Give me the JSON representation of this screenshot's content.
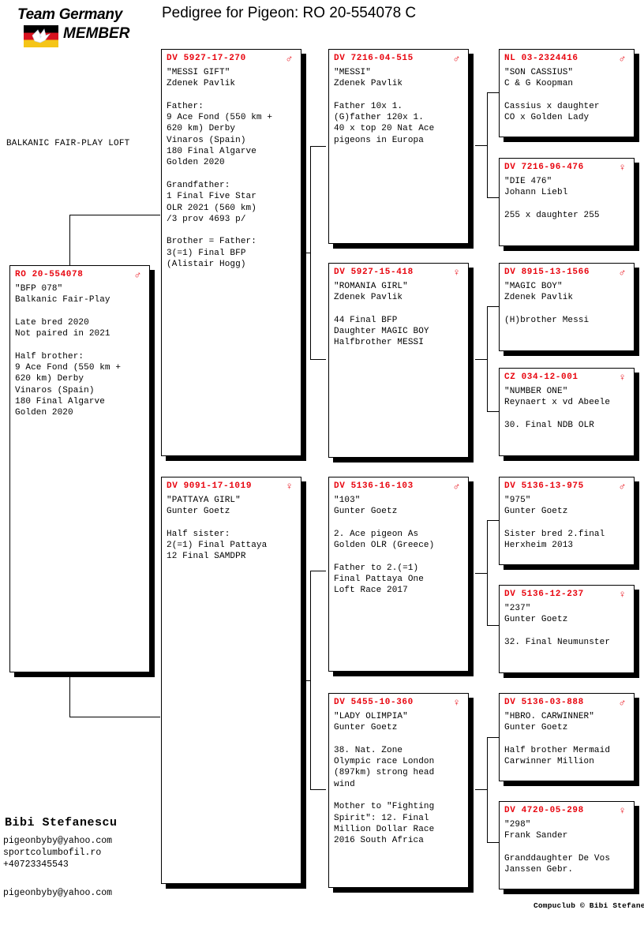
{
  "logo": {
    "line1": "Team Germany",
    "line2": "MEMBER",
    "flag_colors": [
      "#000000",
      "#d8121f",
      "#f5c518"
    ],
    "bird_icon": "dove-icon"
  },
  "header": {
    "title": "Pedigree for Pigeon: RO  20-554078 C"
  },
  "loft": {
    "name": "BALKANIC FAIR-PLAY LOFT"
  },
  "colors": {
    "ring_number": "#e8050f",
    "text": "#000000",
    "background": "#ffffff",
    "shadow": "#000000"
  },
  "symbols": {
    "male": "♂",
    "female": "♀"
  },
  "subject": {
    "ring": "RO   20-554078",
    "sex": "male",
    "body": "\"BFP 078\"\nBalkanic Fair-Play\n\nLate bred 2020\nNot paired in 2021\n\nHalf brother:\n9 Ace Fond (550 km +\n620 km) Derby\nVinaros (Spain)\n180 Final Algarve\nGolden 2020"
  },
  "generation1": [
    {
      "ring": "DV   5927-17-270",
      "sex": "male",
      "body": "\"MESSI GIFT\"\nZdenek Pavlik\n\nFather:\n9 Ace Fond (550 km +\n620 km) Derby\nVinaros (Spain)\n180 Final Algarve\nGolden 2020\n\nGrandfather:\n1 Final Five Star\nOLR 2021 (560 km)\n/3 prov 4693 p/\n\nBrother = Father:\n3(=1) Final BFP\n(Alistair Hogg)"
    },
    {
      "ring": "DV   9091-17-1019",
      "sex": "female",
      "body": "\"PATTAYA GIRL\"\nGunter Goetz\n\nHalf sister:\n2(=1) Final Pattaya\n12 Final SAMDPR"
    }
  ],
  "generation2": [
    {
      "ring": "DV   7216-04-515",
      "sex": "male",
      "body": "\"MESSI\"\nZdenek Pavlik\n\nFather 10x 1.\n(G)father 120x 1.\n40 x top 20 Nat Ace\npigeons in Europa"
    },
    {
      "ring": "DV   5927-15-418",
      "sex": "female",
      "body": "\"ROMANIA GIRL\"\nZdenek Pavlik\n\n44 Final BFP\nDaughter MAGIC BOY\nHalfbrother MESSI"
    },
    {
      "ring": "DV   5136-16-103",
      "sex": "male",
      "body": "\"103\"\nGunter Goetz\n\n2. Ace pigeon As\nGolden OLR (Greece)\n\nFather to 2.(=1)\nFinal Pattaya One\nLoft Race 2017"
    },
    {
      "ring": "DV   5455-10-360",
      "sex": "female",
      "body": "\"LADY OLIMPIA\"\nGunter Goetz\n\n38. Nat. Zone\nOlympic race London\n(897km) strong head\nwind\n\nMother to \"Fighting\nSpirit\": 12. Final\nMillion Dollar Race\n2016 South Africa"
    }
  ],
  "generation3": [
    {
      "ring": "NL   03-2324416",
      "sex": "male",
      "body": "\"SON CASSIUS\"\nC & G Koopman\n\nCassius x daughter\nCO x Golden Lady"
    },
    {
      "ring": "DV   7216-96-476",
      "sex": "female",
      "body": "\"DIE 476\"\nJohann Liebl\n\n255 x daughter 255"
    },
    {
      "ring": "DV   8915-13-1566",
      "sex": "male",
      "body": "\"MAGIC BOY\"\nZdenek Pavlik\n\n(H)brother Messi"
    },
    {
      "ring": "CZ   034-12-001",
      "sex": "female",
      "body": "\"NUMBER ONE\"\nReynaert x vd Abeele\n\n30. Final NDB OLR"
    },
    {
      "ring": "DV   5136-13-975",
      "sex": "male",
      "body": "\"975\"\nGunter Goetz\n\nSister bred 2.final\nHerxheim 2013"
    },
    {
      "ring": "DV   5136-12-237",
      "sex": "female",
      "body": "\"237\"\nGunter Goetz\n\n32. Final Neumunster"
    },
    {
      "ring": "DV   5136-03-888",
      "sex": "male",
      "body": "\"HBRO. CARWINNER\"\nGunter Goetz\n\nHalf brother Mermaid\nCarwinner Million"
    },
    {
      "ring": "DV   4720-05-298",
      "sex": "female",
      "body": "\"298\"\nFrank Sander\n\nGranddaughter De Vos\nJanssen Gebr."
    }
  ],
  "footer": {
    "name": "Bibi Stefanescu",
    "contact": [
      "pigeonbyby@yahoo.com",
      "sportcolumbofil.ro",
      "+40723345543"
    ],
    "email_repeat": "pigeonbyby@yahoo.com",
    "credit": "Compuclub © Bibi Stefanescu"
  }
}
